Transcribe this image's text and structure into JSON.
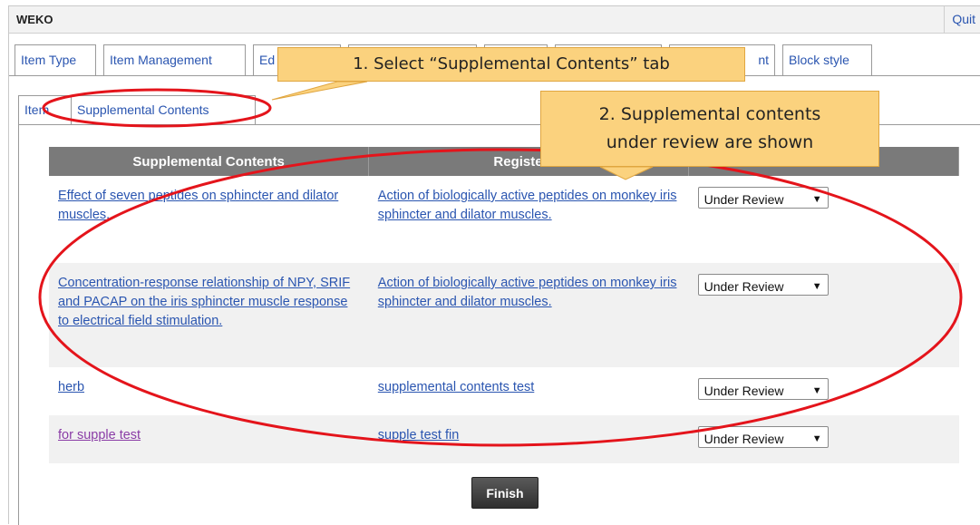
{
  "app": {
    "title": "WEKO",
    "quit_label": "Quit"
  },
  "tabs": [
    {
      "label": "Item Type"
    },
    {
      "label": "Item Management"
    },
    {
      "label": "Ed"
    },
    {
      "label": ""
    },
    {
      "label": ""
    },
    {
      "label": ""
    },
    {
      "label": "nt"
    },
    {
      "label": "Block style"
    }
  ],
  "subtabs": [
    {
      "label": "Item"
    },
    {
      "label": "Supplemental Contents"
    }
  ],
  "table": {
    "headers": [
      "Supplemental Contents",
      "Registered",
      ""
    ],
    "rows": [
      {
        "supplemental": "Effect of seven peptides on sphincter and dilator muscles.",
        "registered": "Action of biologically active peptides on monkey iris sphincter and dilator muscles.",
        "status": "Under Review"
      },
      {
        "supplemental": "Concentration-response relationship of NPY, SRIF and PACAP on the iris sphincter muscle response to electrical field stimulation.",
        "registered": "Action of biologically active peptides on monkey iris sphincter and dilator muscles.",
        "status": "Under Review"
      },
      {
        "supplemental": "herb",
        "registered": "supplemental contents test",
        "status": "Under Review"
      },
      {
        "supplemental": "for supple test",
        "registered": "supple test fin",
        "status": "Under Review"
      }
    ]
  },
  "finish_label": "Finish",
  "annotations": {
    "step1": "1. Select “Supplemental Contents” tab",
    "step2_line1": "2. Supplemental contents",
    "step2_line2": "under review are shown"
  },
  "colors": {
    "annotation_red": "#e4141b",
    "callout_fill": "#fbd27e",
    "header_gray": "#7a7a7a",
    "link_blue": "#2a55b0",
    "visited_purple": "#8a3ca6"
  }
}
